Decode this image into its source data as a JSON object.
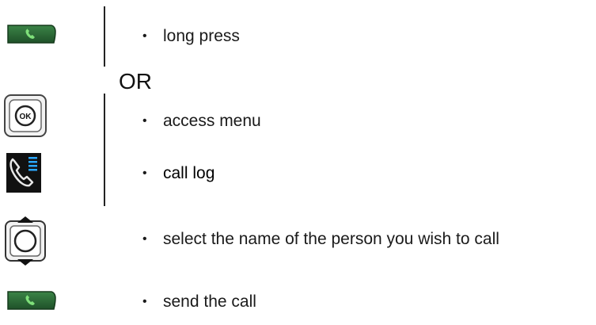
{
  "separator_word": "OR",
  "steps": [
    {
      "icon": "green-call-key-icon",
      "bullet": "•",
      "text": "long press"
    },
    {
      "icon": "ok-button-icon",
      "bullet": "•",
      "text": "access menu"
    },
    {
      "icon": "call-log-icon",
      "bullet": "•",
      "text": "call log"
    },
    {
      "icon": "navigator-up-down-icon",
      "bullet": "•",
      "text": "select the name of the person you wish to call"
    },
    {
      "icon": "green-call-key-icon",
      "bullet": "•",
      "text": "send the call"
    }
  ],
  "colors": {
    "call_key": "#2f6f3a",
    "call_key_dark": "#1d4a27",
    "handset_green": "#7fe07a",
    "call_log_bg": "#111111",
    "call_log_lines": "#2aa8ff",
    "line": "#222222"
  }
}
